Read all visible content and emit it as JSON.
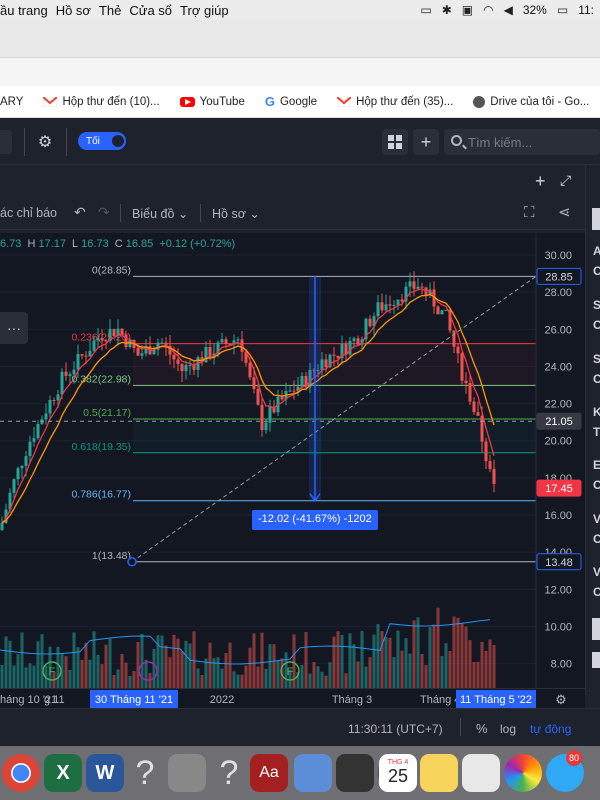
{
  "menubar": {
    "items": [
      "ầu trang",
      "Hồ sơ",
      "Thẻ",
      "Cửa sổ",
      "Trợ giúp"
    ],
    "battery": "32%",
    "clock": "11:"
  },
  "bookmarks": [
    {
      "label": "ARY",
      "icon": "none"
    },
    {
      "label": "Hộp thư đến (10)...",
      "icon": "gmail-icon"
    },
    {
      "label": "YouTube",
      "icon": "youtube-icon"
    },
    {
      "label": "Google",
      "icon": "google-icon"
    },
    {
      "label": "Hộp thư đến (35)...",
      "icon": "gmail-icon"
    },
    {
      "label": "Drive của tôi - Go...",
      "icon": "globe-icon"
    }
  ],
  "header": {
    "toggle_label": "Tối",
    "search_placeholder": "Tìm kiếm..."
  },
  "toolbar": {
    "indicators": "ác chỉ báo",
    "chart_label": "Biểu đồ",
    "profile_label": "Hồ sơ"
  },
  "ohlc": {
    "o_value": "6.73",
    "h_label": "H",
    "h_value": "17.17",
    "l_label": "L",
    "l_value": "16.73",
    "c_label": "C",
    "c_value": "16.85",
    "change": "+0.12 (+0.72%)"
  },
  "fib_levels": [
    {
      "label": "0(28.85)",
      "value": 28.85,
      "color": "#b2b5be"
    },
    {
      "label": "0.236(25.23)",
      "value": 25.23,
      "color": "#f23645"
    },
    {
      "label": "0.382(22.98)",
      "value": 22.98,
      "color": "#81c784"
    },
    {
      "label": "0.5(21.17)",
      "value": 21.17,
      "color": "#4caf50"
    },
    {
      "label": "0.618(19.35)",
      "value": 19.35,
      "color": "#089981"
    },
    {
      "label": "0.786(16.77)",
      "value": 16.77,
      "color": "#64b5f6"
    },
    {
      "label": "1(13.48)",
      "value": 13.48,
      "color": "#b2b5be"
    }
  ],
  "measure_label": "-12.02 (-41.67%) -1202",
  "price_axis": {
    "ticks": [
      "30.00",
      "28.00",
      "26.00",
      "24.00",
      "22.00",
      "20.00",
      "18.00",
      "16.00",
      "14.00",
      "12.00",
      "10.00",
      "8.00"
    ],
    "badges": [
      {
        "text": "28.85",
        "value": 28.85,
        "style": "outline"
      },
      {
        "text": "21.05",
        "value": 21.05,
        "style": "dark"
      },
      {
        "text": "17.45",
        "value": 17.45,
        "style": "red"
      },
      {
        "text": "13.48",
        "value": 13.48,
        "style": "outline"
      }
    ]
  },
  "time_axis": {
    "labels": [
      "háng 10 '21",
      "g 11",
      "30 Tháng 11 '21",
      "2022",
      "Tháng 3",
      "Tháng 4",
      "11 Tháng 5 '22"
    ]
  },
  "status": {
    "time": "11:30:11 (UTC+7)",
    "percent": "%",
    "log": "log",
    "auto": "tự động"
  },
  "right_panel_letters": [
    "A",
    "C",
    "S",
    "C",
    "S",
    "C",
    "K",
    "T",
    "E",
    "C",
    "V",
    "C",
    "V",
    "C"
  ],
  "event_markers": [
    "F",
    "F"
  ],
  "dock": {
    "calendar_month": "THG 4",
    "calendar_day": "25",
    "badge_count": "80"
  },
  "colors": {
    "up": "#26a69a",
    "down": "#ef5350",
    "ema_fast": "#f23645",
    "ema_slow": "#ff9800",
    "accent": "#2962ff"
  }
}
